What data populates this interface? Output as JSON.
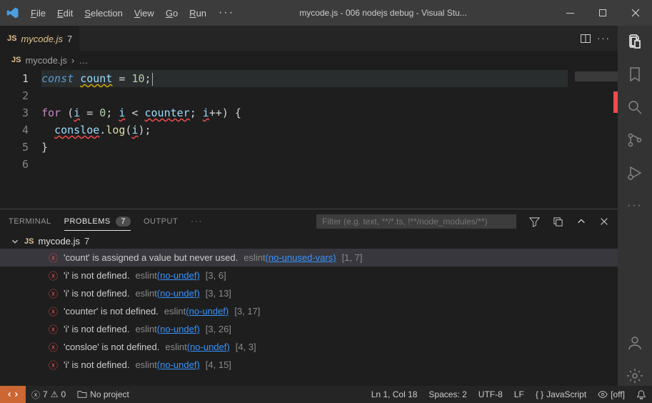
{
  "title": "mycode.js - 006 nodejs debug - Visual Stu...",
  "menu": {
    "file": "File",
    "edit": "Edit",
    "selection": "Selection",
    "view": "View",
    "go": "Go",
    "run": "Run"
  },
  "tab": {
    "filename": "mycode.js",
    "badge": "7"
  },
  "breadcrumb": {
    "filename": "mycode.js"
  },
  "code": {
    "lines": [
      "1",
      "2",
      "3",
      "4",
      "5",
      "6"
    ],
    "l1": {
      "kw": "const",
      "var": "count",
      "eq": " = ",
      "num": "10",
      "semi": ";"
    },
    "l3": {
      "kw": "for",
      "op1": " (",
      "i1": "i",
      "eq": " = ",
      "num": "0",
      "semi1": "; ",
      "i2": "i",
      "lt": " < ",
      "counter": "counter",
      "semi2": "; ",
      "i3": "i",
      "inc": "++",
      "close": ") {"
    },
    "l4": {
      "obj": "consloe",
      "dot": ".",
      "fn": "log",
      "open": "(",
      "i": "i",
      "close": ");"
    },
    "l5": {
      "brace": "}"
    }
  },
  "panel": {
    "tabs": {
      "terminal": "TERMINAL",
      "problems": "PROBLEMS",
      "output": "OUTPUT",
      "badge": "7"
    },
    "filter_placeholder": "Filter (e.g. text, **/*.ts, !**/node_modules/**)",
    "file": {
      "name": "mycode.js",
      "count": "7"
    },
    "rows": [
      {
        "msg": "'count' is assigned a value but never used.",
        "src": "eslint",
        "rule": "(no-unused-vars)",
        "loc": "[1, 7]"
      },
      {
        "msg": "'i' is not defined.",
        "src": "eslint",
        "rule": "(no-undef)",
        "loc": "[3, 6]"
      },
      {
        "msg": "'i' is not defined.",
        "src": "eslint",
        "rule": "(no-undef)",
        "loc": "[3, 13]"
      },
      {
        "msg": "'counter' is not defined.",
        "src": "eslint",
        "rule": "(no-undef)",
        "loc": "[3, 17]"
      },
      {
        "msg": "'i' is not defined.",
        "src": "eslint",
        "rule": "(no-undef)",
        "loc": "[3, 26]"
      },
      {
        "msg": "'consloe' is not defined.",
        "src": "eslint",
        "rule": "(no-undef)",
        "loc": "[4, 3]"
      },
      {
        "msg": "'i' is not defined.",
        "src": "eslint",
        "rule": "(no-undef)",
        "loc": "[4, 15]"
      }
    ]
  },
  "status": {
    "errors": "7",
    "warnings": "0",
    "project": "No project",
    "pos": "Ln 1, Col 18",
    "spaces": "Spaces: 2",
    "encoding": "UTF-8",
    "eol": "LF",
    "lang": "JavaScript",
    "feedback": "[off]"
  }
}
